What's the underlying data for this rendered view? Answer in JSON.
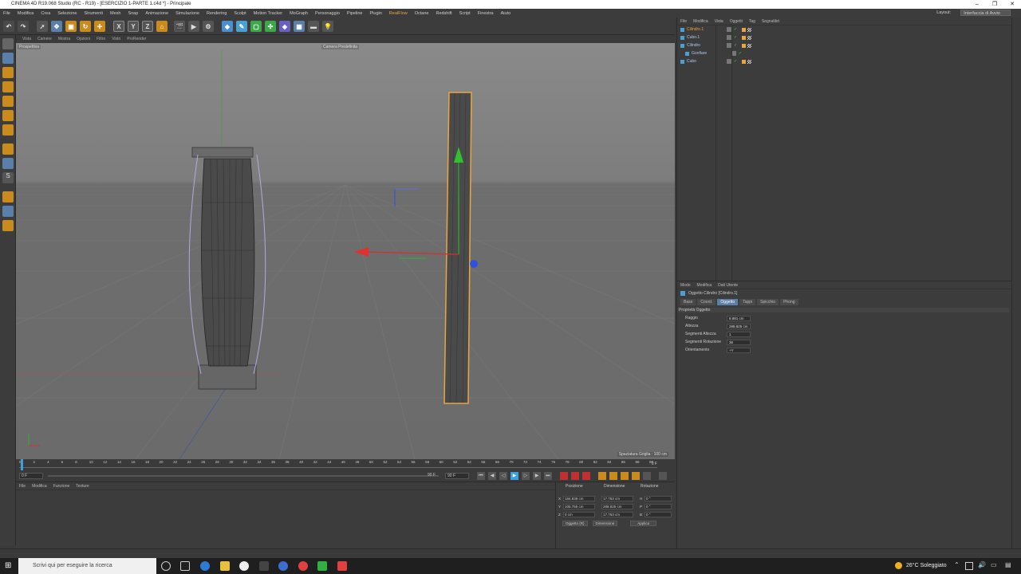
{
  "window": {
    "title": "CINEMA 4D R19.068 Studio (RC - R19) - [ESERCIZIO 1-PARTE 1.c4d *] - Principale",
    "minimize": "–",
    "maximize": "❐",
    "close": "✕"
  },
  "menubar": {
    "items": [
      "File",
      "Modifica",
      "Crea",
      "Selezione",
      "Strumenti",
      "Mesh",
      "Snap",
      "Animazione",
      "Simulazione",
      "Rendering",
      "Scolpt",
      "Motion Tracker",
      "MoGraph",
      "Personaggio",
      "Pipeline",
      "Plugin",
      "RealFlow",
      "Octane",
      "Redshift",
      "Script",
      "Finestra",
      "Aiuto"
    ],
    "highlight": "RealFlow",
    "layout_label": "Layout:",
    "layout_value": "Interfaccia di Avvio"
  },
  "viewport_menu": [
    "Vista",
    "Camere",
    "Mostra",
    "Opzioni",
    "Filtro",
    "Visto",
    "ProRender"
  ],
  "viewport": {
    "view_name": "Prospettiva",
    "camera": "Camera Predefinita",
    "grid_spacing": "Spaziatura Griglia : 100 cm"
  },
  "timeline": {
    "ticks": [
      "0",
      "2",
      "4",
      "6",
      "8",
      "10",
      "12",
      "14",
      "16",
      "18",
      "20",
      "22",
      "24",
      "26",
      "28",
      "30",
      "32",
      "34",
      "36",
      "38",
      "40",
      "42",
      "44",
      "46",
      "48",
      "50",
      "52",
      "54",
      "56",
      "58",
      "60",
      "62",
      "64",
      "66",
      "68",
      "70",
      "72",
      "74",
      "76",
      "78",
      "80",
      "82",
      "84",
      "86",
      "88",
      "90"
    ],
    "end_label": "0 F",
    "current_frame": "0 F",
    "start_field": "0 F",
    "end_field": "90 F",
    "max_field": "90 F"
  },
  "object_manager": {
    "menu": [
      "File",
      "Modifica",
      "Vista",
      "Oggetti",
      "Tag",
      "Segnalibri"
    ],
    "objects": [
      {
        "name": "Cilindro.1",
        "selected": true
      },
      {
        "name": "Cubo.1",
        "selected": false
      },
      {
        "name": "Cilindro",
        "selected": false
      },
      {
        "name": "Gonfiare",
        "selected": false
      },
      {
        "name": "Cubo",
        "selected": false
      }
    ]
  },
  "attribute_manager": {
    "menu": [
      "Modo",
      "Modifica",
      "Dati Utente"
    ],
    "object_title": "Oggetto Cilindro [Cilindro.1]",
    "tabs": [
      "Base",
      "Coord.",
      "Oggetto",
      "Tappi",
      "Spicchio",
      "Phong"
    ],
    "active_tab": "Oggetto",
    "section": "Proprietà Oggetto",
    "fields": [
      {
        "label": "Raggio",
        "value": "8.881 cm"
      },
      {
        "label": "Altezza",
        "value": "288.825 cm"
      },
      {
        "label": "Segmenti Altezza",
        "value": "1"
      },
      {
        "label": "Segmenti Rotazione",
        "value": "36"
      },
      {
        "label": "Orientamento",
        "value": "+Y"
      }
    ]
  },
  "material_manager": {
    "menu": [
      "File",
      "Modifica",
      "Funzione",
      "Texture"
    ]
  },
  "coordinates": {
    "headers": [
      "Posizione",
      "Dimensione",
      "Rotazione"
    ],
    "rows": [
      {
        "axis": "X",
        "pos": "184.838 cm",
        "size": "17.763 cm",
        "rot_axis": "H",
        "rot": "0 °"
      },
      {
        "axis": "Y",
        "pos": "105.755 cm",
        "size": "288.825 cm",
        "rot_axis": "P",
        "rot": "0 °"
      },
      {
        "axis": "Z",
        "pos": "0 cm",
        "size": "17.763 cm",
        "rot_axis": "B",
        "rot": "0 °"
      }
    ],
    "mode_object": "Oggetto (R)",
    "mode_size": "Dimensione",
    "apply": "Applica"
  },
  "taskbar": {
    "search_placeholder": "Scrivi qui per eseguire la ricerca",
    "weather": "26°C Soleggiato"
  },
  "colors": {
    "accent": "#e8a640",
    "selection": "#5a7fa8",
    "axis_x": "#d03030",
    "axis_y": "#30b030",
    "axis_z": "#3050e0"
  }
}
